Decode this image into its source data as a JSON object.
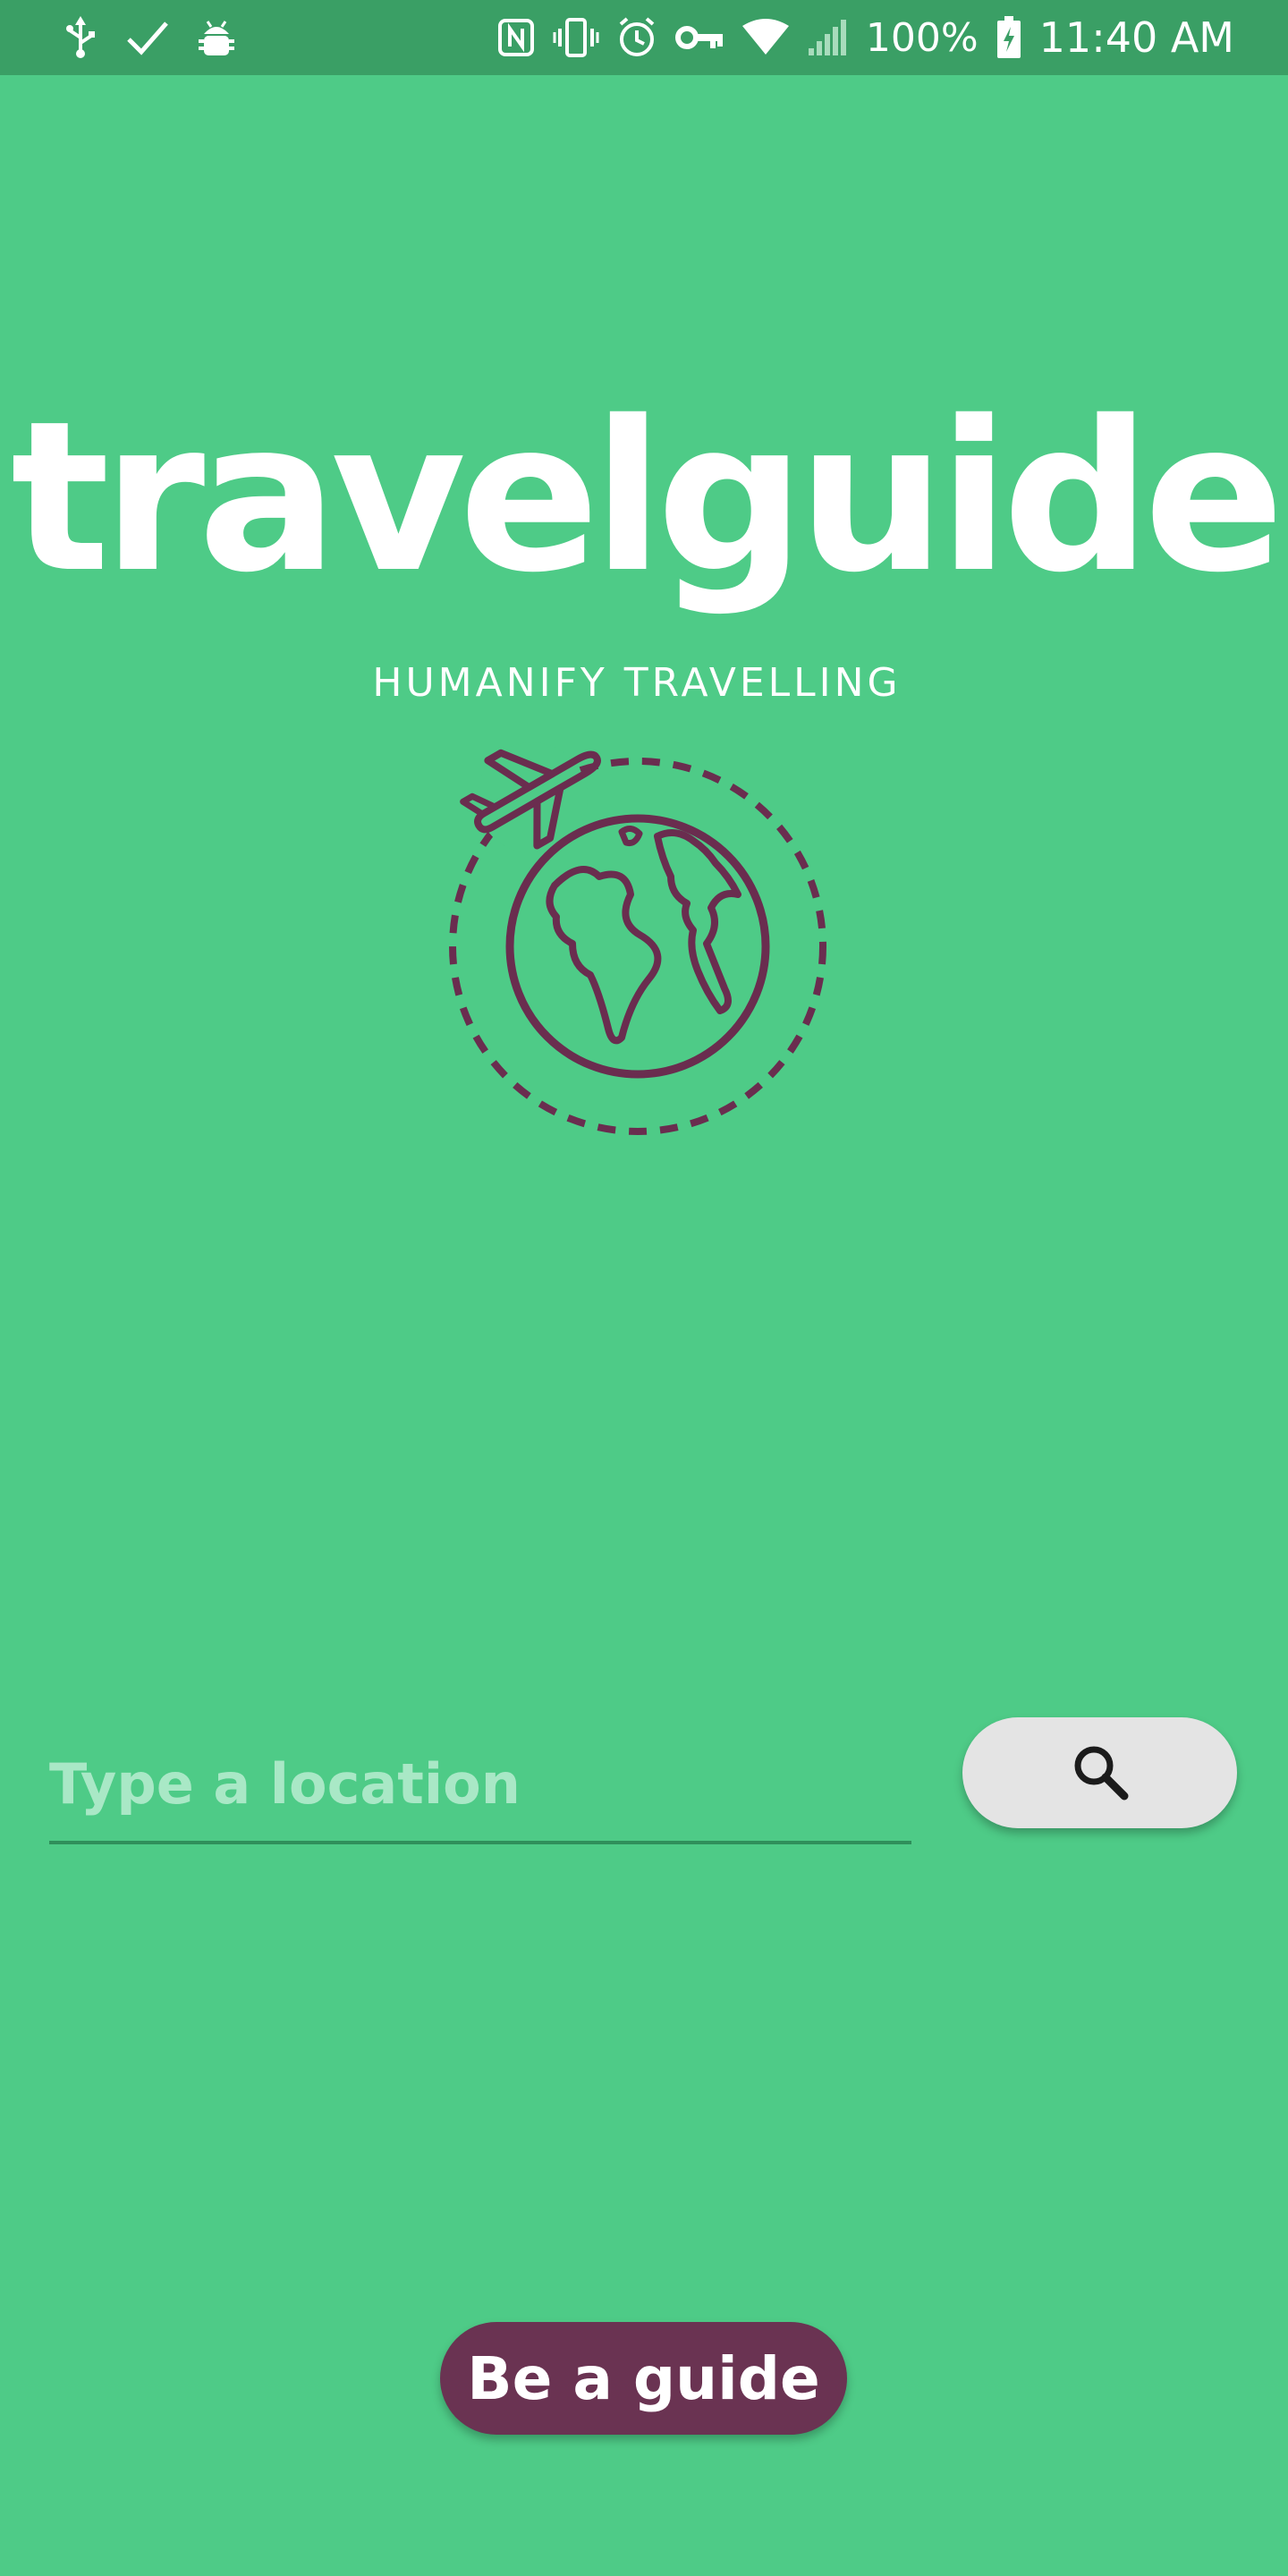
{
  "status_bar": {
    "icons_left": [
      "usb-icon",
      "check-icon",
      "android-debug-icon"
    ],
    "icons_right": [
      "nfc-icon",
      "vibrate-icon",
      "alarm-icon",
      "vpn-key-icon",
      "wifi-icon",
      "cell-signal-icon",
      "battery-charging-icon"
    ],
    "battery_text": "100%",
    "time": "11:40 AM"
  },
  "logo": {
    "title": "travelguide",
    "tagline": "HUMANIFY TRAVELLING",
    "graphic": "globe-with-airplane-icon",
    "graphic_color": "#6a2d4f",
    "title_color": "#ffffff"
  },
  "search": {
    "placeholder": "Type a location",
    "value": "",
    "button_icon": "search-icon"
  },
  "actions": {
    "be_a_guide_label": "Be a guide"
  },
  "colors": {
    "background": "#4ecb87",
    "status_bar": "#3a9f65",
    "accent_button": "#6a3352",
    "search_button": "#e4e4e4",
    "placeholder": "#a9e8c6"
  }
}
